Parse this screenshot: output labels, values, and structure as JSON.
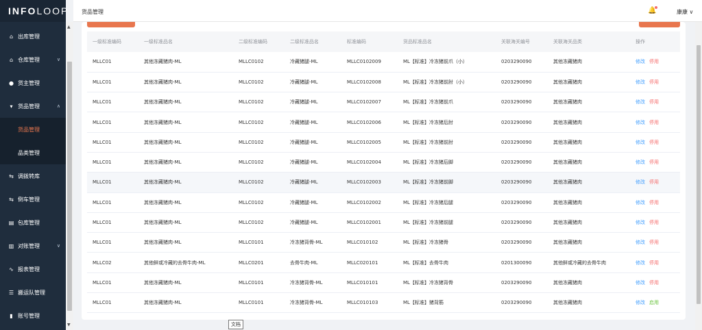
{
  "logo": {
    "bold": "INFO",
    "thin": "LOOP"
  },
  "header": {
    "title": "货品管理",
    "user": "康康",
    "user_chevron": "∨"
  },
  "sidebar": {
    "items": [
      {
        "label": "出库管理",
        "icon": "home-icon",
        "has_chevron": false
      },
      {
        "label": "仓库管理",
        "icon": "home-icon",
        "has_chevron": true
      },
      {
        "label": "货主管理",
        "icon": "user-icon",
        "has_chevron": false
      },
      {
        "label": "货品管理",
        "icon": "cart-icon",
        "has_chevron": true,
        "expanded": true
      },
      {
        "label": "调拨转库",
        "icon": "transfer-icon",
        "has_chevron": false
      },
      {
        "label": "倒车管理",
        "icon": "transfer-icon",
        "has_chevron": false
      },
      {
        "label": "包库管理",
        "icon": "document-icon",
        "has_chevron": false
      },
      {
        "label": "对账管理",
        "icon": "bar-chart-icon",
        "has_chevron": true
      },
      {
        "label": "报表管理",
        "icon": "line-chart-icon",
        "has_chevron": false
      },
      {
        "label": "搬运队管理",
        "icon": "list-icon",
        "has_chevron": false
      },
      {
        "label": "账号管理",
        "icon": "bookmark-icon",
        "has_chevron": false
      }
    ],
    "subitems": [
      {
        "label": "货品管理",
        "active": true
      },
      {
        "label": "品类管理",
        "active": false
      }
    ]
  },
  "table": {
    "headers": [
      "一级标准编码",
      "一级标准品名",
      "二级标准编码",
      "二级标准品名",
      "标准编码",
      "货品标准品名",
      "关联海关编号",
      "关联海关品类",
      "操作"
    ],
    "rows": [
      [
        "MLLC01",
        "其他冻藏猪肉-ML",
        "MLLC0102",
        "冷藏猪腿-ML",
        "MLLC0102009",
        "ML【标准】冷冻猪前爪（小）",
        "0203290090",
        "其他冻藏猪肉",
        "修改",
        "停用"
      ],
      [
        "MLLC01",
        "其他冻藏猪肉-ML",
        "MLLC0102",
        "冷藏猪腿-ML",
        "MLLC0102008",
        "ML【标准】冷冻猪前肘（小）",
        "0203290090",
        "其他冻藏猪肉",
        "修改",
        "停用"
      ],
      [
        "MLLC01",
        "其他冻藏猪肉-ML",
        "MLLC0102",
        "冷藏猪腿-ML",
        "MLLC0102007",
        "ML【标准】冷冻猪前爪",
        "0203290090",
        "其他冻藏猪肉",
        "修改",
        "停用"
      ],
      [
        "MLLC01",
        "其他冻藏猪肉-ML",
        "MLLC0102",
        "冷藏猪腿-ML",
        "MLLC0102006",
        "ML【标准】冷冻猪后肘",
        "0203290090",
        "其他冻藏猪肉",
        "修改",
        "停用"
      ],
      [
        "MLLC01",
        "其他冻藏猪肉-ML",
        "MLLC0102",
        "冷藏猪腿-ML",
        "MLLC0102005",
        "ML【标准】冷冻猪前肘",
        "0203290090",
        "其他冻藏猪肉",
        "修改",
        "停用"
      ],
      [
        "MLLC01",
        "其他冻藏猪肉-ML",
        "MLLC0102",
        "冷藏猪腿-ML",
        "MLLC0102004",
        "ML【标准】冷冻猪后脚",
        "0203290090",
        "其他冻藏猪肉",
        "修改",
        "停用"
      ],
      [
        "MLLC01",
        "其他冻藏猪肉-ML",
        "MLLC0102",
        "冷藏猪腿-ML",
        "MLLC0102003",
        "ML【标准】冷冻猪前脚",
        "0203290090",
        "其他冻藏猪肉",
        "修改",
        "停用"
      ],
      [
        "MLLC01",
        "其他冻藏猪肉-ML",
        "MLLC0102",
        "冷藏猪腿-ML",
        "MLLC0102002",
        "ML【标准】冷冻猪后腿",
        "0203290090",
        "其他冻藏猪肉",
        "修改",
        "停用"
      ],
      [
        "MLLC01",
        "其他冻藏猪肉-ML",
        "MLLC0102",
        "冷藏猪腿-ML",
        "MLLC0102001",
        "ML【标准】冷冻猪前腿",
        "0203290090",
        "其他冻藏猪肉",
        "修改",
        "停用"
      ],
      [
        "MLLC01",
        "其他冻藏猪肉-ML",
        "MLLC0101",
        "冷冻猪背骨-ML",
        "MLLC010102",
        "ML【标准】冷冻猪骨",
        "0203290090",
        "其他冻藏猪肉",
        "修改",
        "停用"
      ],
      [
        "MLLC02",
        "其他鲜或冷藏的去骨牛肉-ML",
        "MLLC0201",
        "去骨牛肉-ML",
        "MLLC020101",
        "ML【标准】去骨牛肉",
        "0201300090",
        "其他鲜或冷藏的去骨牛肉",
        "修改",
        "停用"
      ],
      [
        "MLLC01",
        "其他冻藏猪肉-ML",
        "MLLC0101",
        "冷冻猪背骨-ML",
        "MLLC010101",
        "ML【标准】冷冻猪背骨",
        "0203290090",
        "其他冻藏猪肉",
        "修改",
        "停用"
      ],
      [
        "MLLC01",
        "其他冻藏猪肉-ML",
        "MLLC0101",
        "冷冻猪背骨-ML",
        "MLLC010103",
        "ML【标准】猪背筋",
        "0203290090",
        "其他冻藏猪肉",
        "修改",
        "启用"
      ]
    ]
  },
  "tooltip": "文档",
  "colors": {
    "sidebar": "#1f2d3d",
    "accent": "#e8764e",
    "link": "#409eff",
    "danger": "#f56c6c",
    "success": "#67c23a"
  }
}
